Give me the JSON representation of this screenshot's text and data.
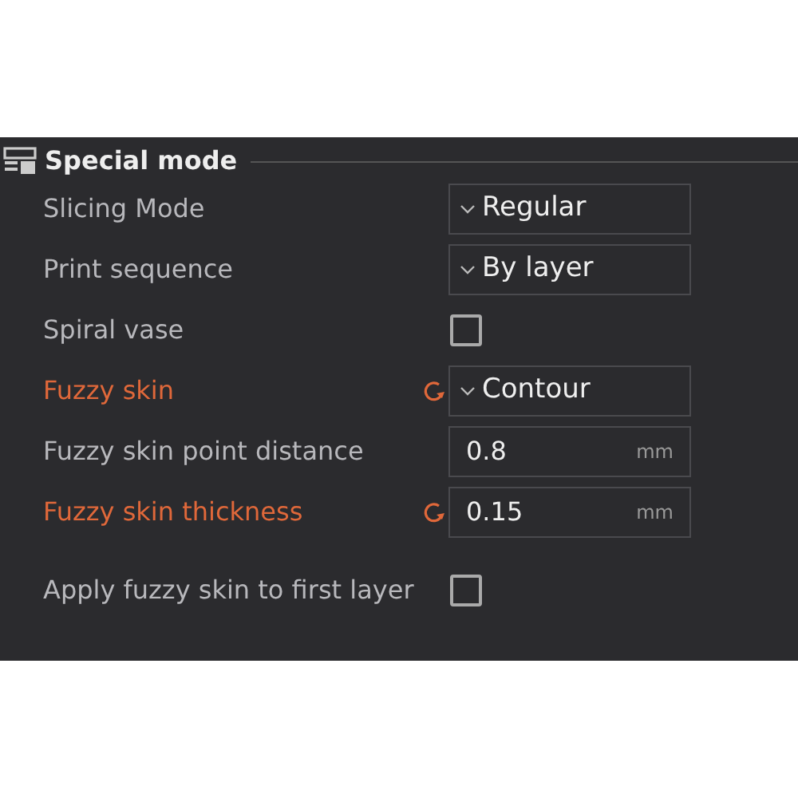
{
  "section": {
    "title": "Special mode"
  },
  "settings": [
    {
      "label": "Slicing Mode",
      "kind": "dropdown",
      "modified": false,
      "value": "Regular"
    },
    {
      "label": "Print sequence",
      "kind": "dropdown",
      "modified": false,
      "value": "By layer"
    },
    {
      "label": "Spiral vase",
      "kind": "checkbox",
      "modified": false,
      "checked": false
    },
    {
      "label": "Fuzzy skin",
      "kind": "dropdown",
      "modified": true,
      "value": "Contour"
    },
    {
      "label": "Fuzzy skin point distance",
      "kind": "number",
      "modified": false,
      "value": "0.8",
      "unit": "mm"
    },
    {
      "label": "Fuzzy skin thickness",
      "kind": "number",
      "modified": true,
      "value": "0.15",
      "unit": "mm"
    },
    {
      "label": "Apply fuzzy skin to first layer",
      "kind": "checkbox",
      "modified": false,
      "checked": false
    }
  ]
}
